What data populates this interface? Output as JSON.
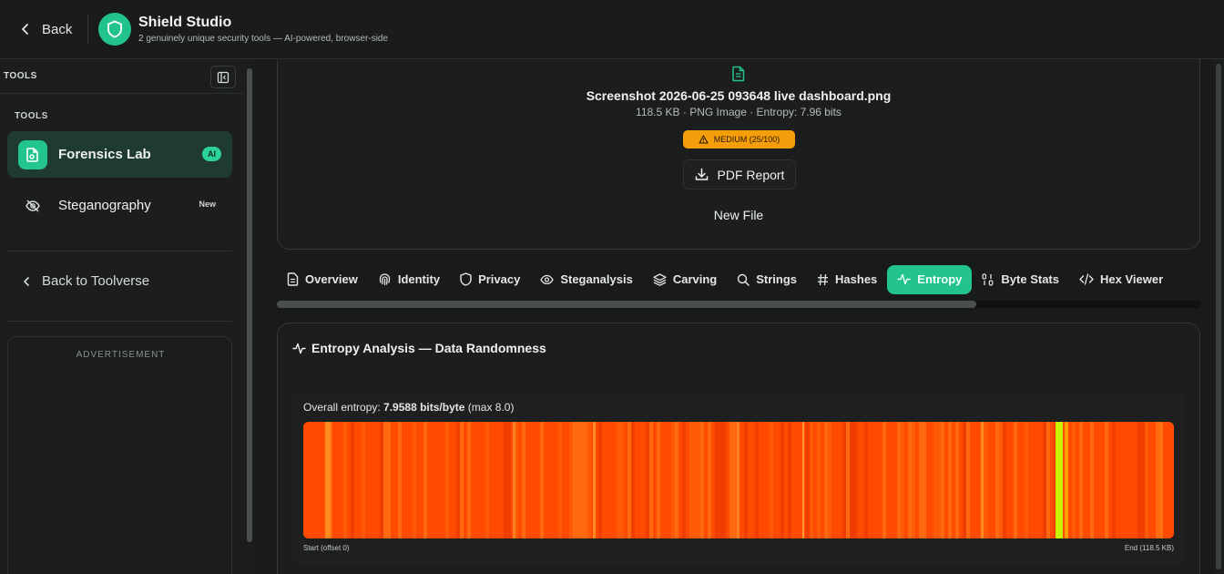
{
  "header": {
    "back_label": "Back",
    "title": "Shield Studio",
    "subtitle": "2 genuinely unique security tools — AI-powered, browser-side"
  },
  "sidebar": {
    "heading": "TOOLS",
    "section_label": "TOOLS",
    "items": [
      {
        "label": "Forensics Lab",
        "badge": "AI",
        "icon": "file-scan-icon",
        "active": true
      },
      {
        "label": "Steganography",
        "badge": "New",
        "icon": "eye-off-icon",
        "active": false
      }
    ],
    "back_link": "Back to Toolverse",
    "ad_label": "ADVERTISEMENT"
  },
  "file": {
    "name": "Screenshot 2026-06-25 093648 live dashboard.png",
    "meta": "118.5 KB · PNG Image · Entropy: 7.96 bits",
    "risk_badge": "MEDIUM (25/100)",
    "pdf_button": "PDF Report",
    "new_file": "New File"
  },
  "tabs": [
    {
      "label": "Overview",
      "icon": "file-text-icon"
    },
    {
      "label": "Identity",
      "icon": "fingerprint-icon"
    },
    {
      "label": "Privacy",
      "icon": "shield-icon"
    },
    {
      "label": "Steganalysis",
      "icon": "eye-icon"
    },
    {
      "label": "Carving",
      "icon": "layers-icon"
    },
    {
      "label": "Strings",
      "icon": "search-icon"
    },
    {
      "label": "Hashes",
      "icon": "hash-icon"
    },
    {
      "label": "Entropy",
      "icon": "activity-icon",
      "active": true
    },
    {
      "label": "Byte Stats",
      "icon": "binary-icon"
    },
    {
      "label": "Hex Viewer",
      "icon": "code-icon"
    }
  ],
  "entropy": {
    "title": "Entropy Analysis — Data Randomness",
    "overall_prefix": "Overall entropy: ",
    "overall_value": "7.9588 bits/byte",
    "overall_suffix": " (max 8.0)",
    "start_label": "Start (offset 0)",
    "end_label": "End (118.5 KB)"
  },
  "colors": {
    "accent": "#22c38e",
    "warning": "#f59e0b",
    "entropy_high": "#ff4a00",
    "entropy_low": "#c8f000"
  }
}
